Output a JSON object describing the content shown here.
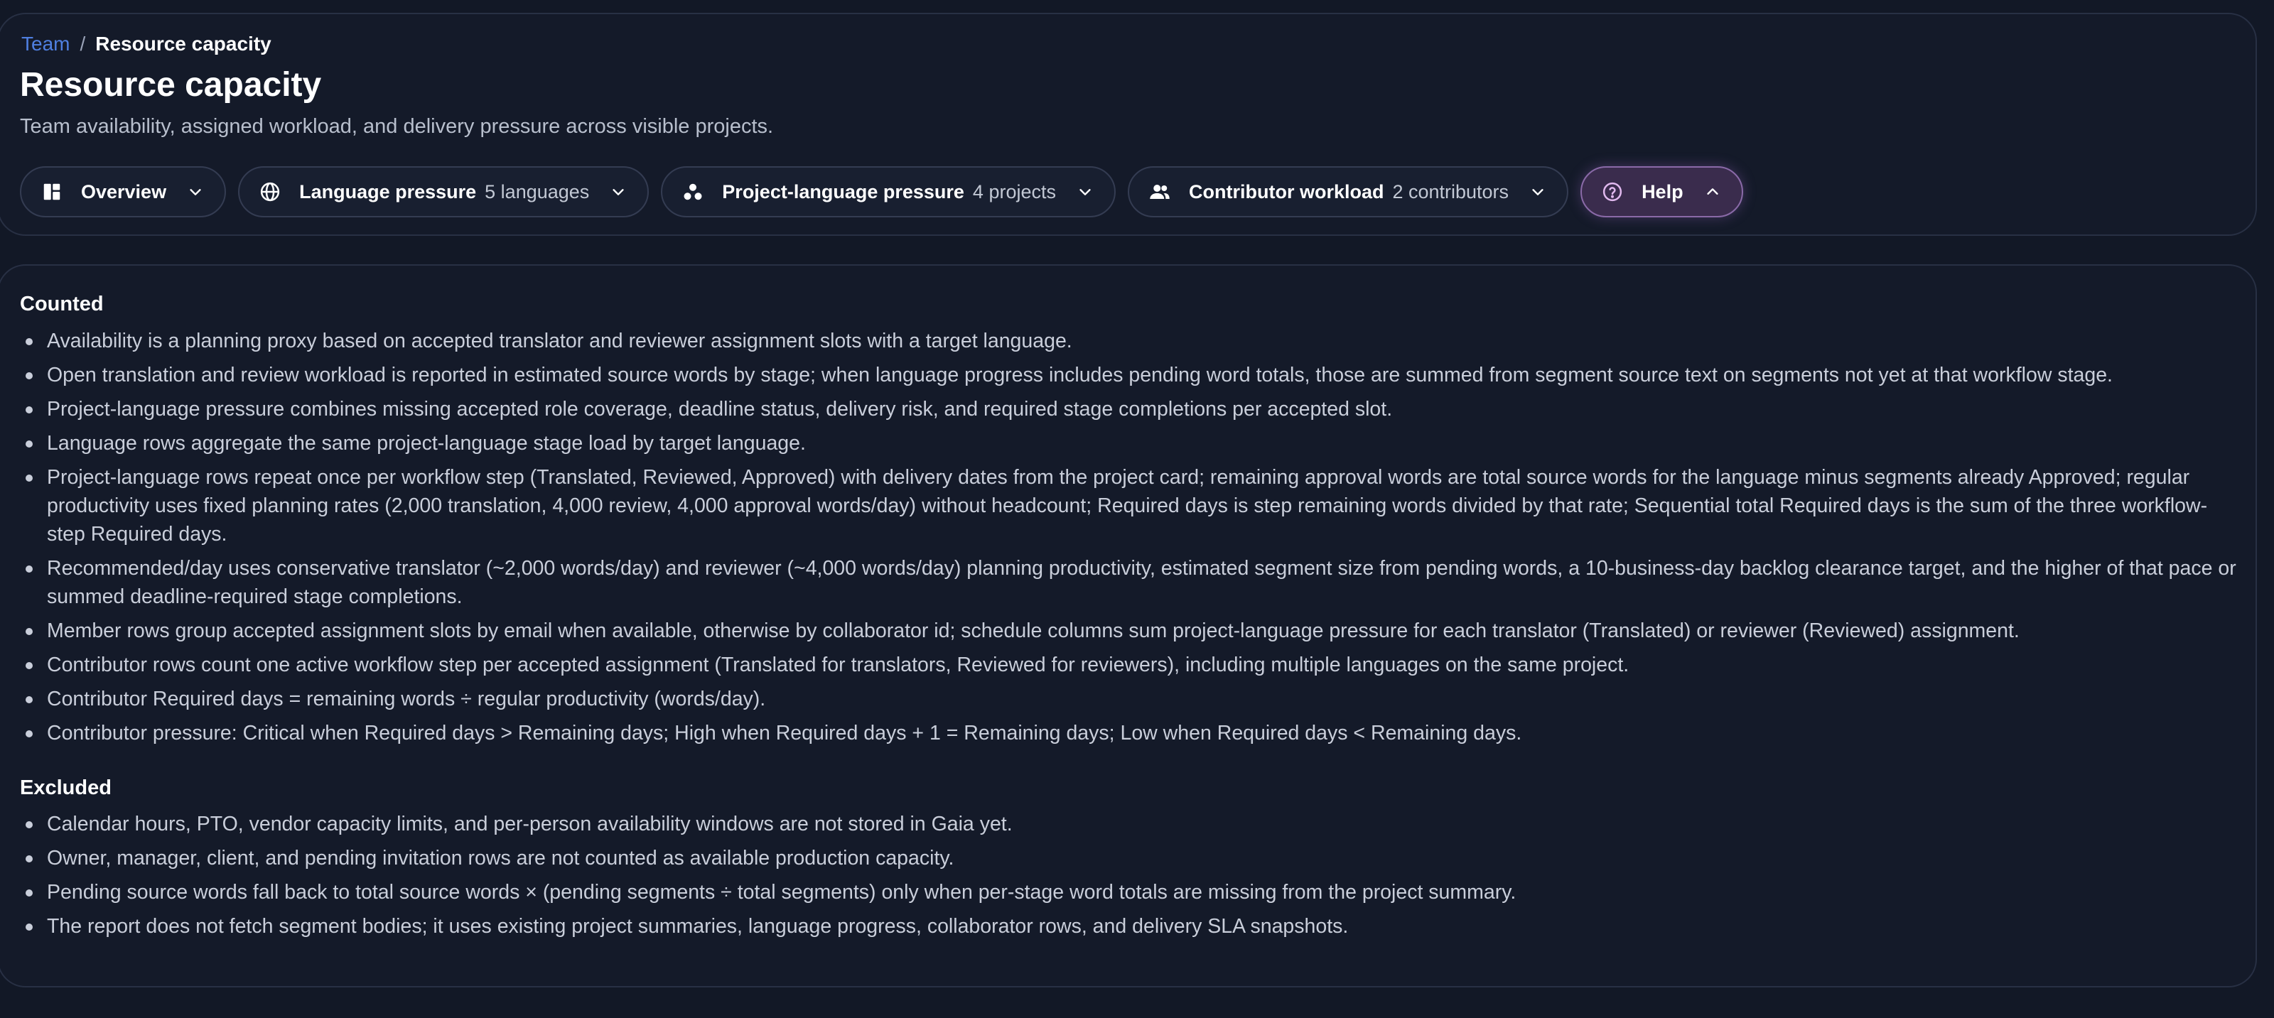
{
  "breadcrumb": {
    "parent": "Team",
    "separator": "/",
    "current": "Resource capacity"
  },
  "page": {
    "title": "Resource capacity",
    "subtitle": "Team availability, assigned workload, and delivery pressure across visible projects."
  },
  "toolbar": {
    "overview": {
      "label": "Overview",
      "icon": "dashboard-icon"
    },
    "language_pressure": {
      "label": "Language pressure",
      "count": "5 languages",
      "icon": "globe-icon"
    },
    "project_language_pressure": {
      "label": "Project-language pressure",
      "count": "4 projects",
      "icon": "group-dots-icon"
    },
    "contributor_workload": {
      "label": "Contributor workload",
      "count": "2 contributors",
      "icon": "people-icon"
    },
    "help": {
      "label": "Help",
      "icon": "help-circle-icon"
    }
  },
  "help": {
    "counted_heading": "Counted",
    "counted": [
      "Availability is a planning proxy based on accepted translator and reviewer assignment slots with a target language.",
      "Open translation and review workload is reported in estimated source words by stage; when language progress includes pending word totals, those are summed from segment source text on segments not yet at that workflow stage.",
      "Project-language pressure combines missing accepted role coverage, deadline status, delivery risk, and required stage completions per accepted slot.",
      "Language rows aggregate the same project-language stage load by target language.",
      "Project-language rows repeat once per workflow step (Translated, Reviewed, Approved) with delivery dates from the project card; remaining approval words are total source words for the language minus segments already Approved; regular productivity uses fixed planning rates (2,000 translation, 4,000 review, 4,000 approval words/day) without headcount; Required days is step remaining words divided by that rate; Sequential total Required days is the sum of the three workflow-step Required days.",
      "Recommended/day uses conservative translator (~2,000 words/day) and reviewer (~4,000 words/day) planning productivity, estimated segment size from pending words, a 10-business-day backlog clearance target, and the higher of that pace or summed deadline-required stage completions.",
      "Member rows group accepted assignment slots by email when available, otherwise by collaborator id; schedule columns sum project-language pressure for each translator (Translated) or reviewer (Reviewed) assignment.",
      "Contributor rows count one active workflow step per accepted assignment (Translated for translators, Reviewed for reviewers), including multiple languages on the same project.",
      "Contributor Required days = remaining words ÷ regular productivity (words/day).",
      "Contributor pressure: Critical when Required days > Remaining days; High when Required days + 1 = Remaining days; Low when Required days < Remaining days."
    ],
    "excluded_heading": "Excluded",
    "excluded": [
      "Calendar hours, PTO, vendor capacity limits, and per-person availability windows are not stored in Gaia yet.",
      "Owner, manager, client, and pending invitation rows are not counted as available production capacity.",
      "Pending source words fall back to total source words × (pending segments ÷ total segments) only when per-stage word totals are missing from the project summary.",
      "The report does not fetch segment bodies; it uses existing project summaries, language progress, collaborator rows, and delivery SLA snapshots."
    ]
  }
}
